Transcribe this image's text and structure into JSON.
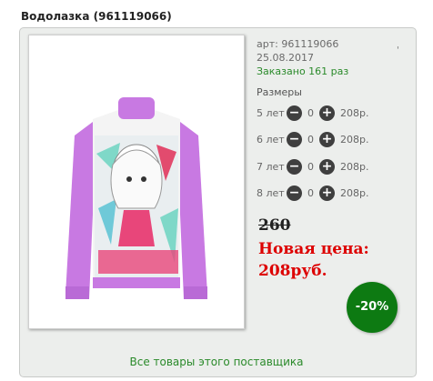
{
  "product": {
    "title": "Водолазка (961119066)",
    "article": "арт: 961119066",
    "date": "25.08.2017",
    "ordered": "Заказано 161 раз",
    "tick": "'"
  },
  "sizes": {
    "heading": "Размеры",
    "items": [
      {
        "label": "5 лет",
        "qty": "0",
        "price": "208р."
      },
      {
        "label": "6 лет",
        "qty": "0",
        "price": "208р."
      },
      {
        "label": "7 лет",
        "qty": "0",
        "price": "208р."
      },
      {
        "label": "8 лет",
        "qty": "0",
        "price": "208р."
      }
    ]
  },
  "pricing": {
    "old_price": "260",
    "new_price_label": "Новая цена:",
    "new_price_value": "208руб.",
    "discount": "-20%"
  },
  "footer": {
    "supplier_link": "Все товары этого поставщика"
  },
  "colors": {
    "accent_green": "#2a8a2a",
    "badge_green": "#0d7a12",
    "price_red": "#dd0000",
    "garment_purple": "#c77be0"
  }
}
